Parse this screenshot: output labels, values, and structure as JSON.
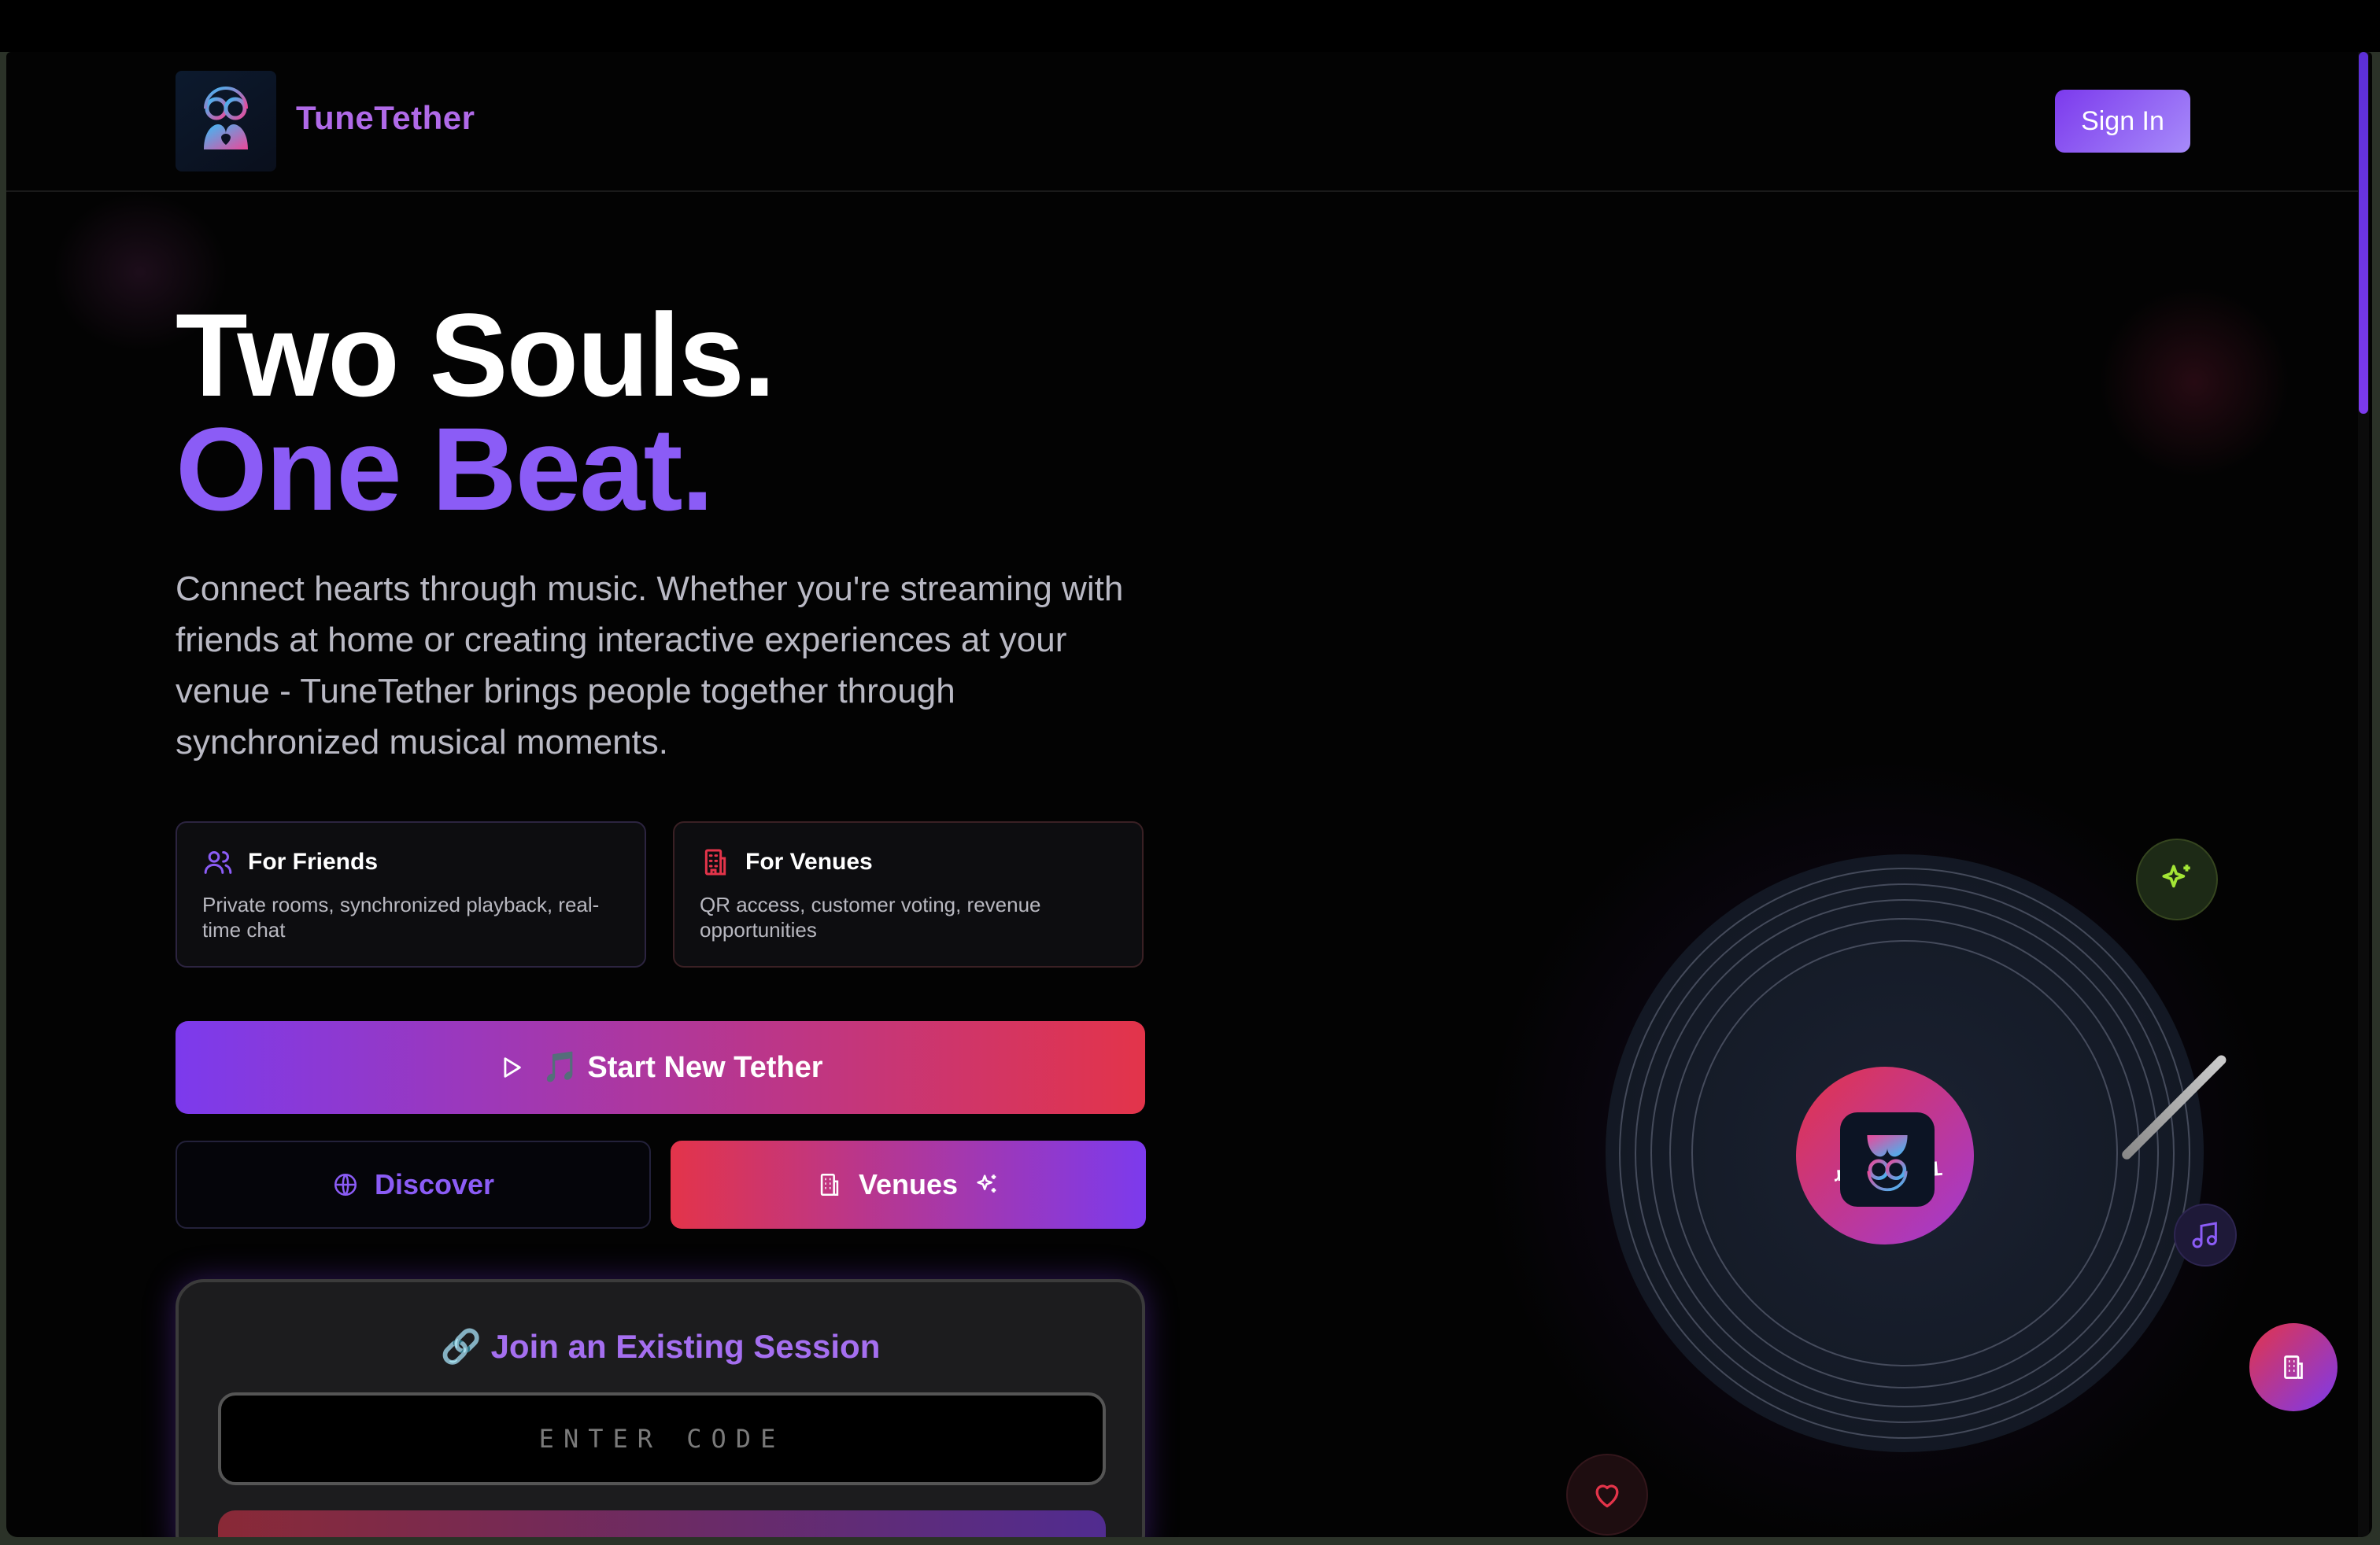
{
  "header": {
    "brand": "TuneTether",
    "signin_label": "Sign In"
  },
  "hero": {
    "line1": "Two Souls.",
    "line2": "One Beat.",
    "description": "Connect hearts through music. Whether you're streaming with friends at home or creating interactive experiences at your venue - TuneTether brings people together through synchronized musical moments."
  },
  "features": [
    {
      "title": "For Friends",
      "desc": "Private rooms, synchronized playback, real-time chat",
      "icon": "users-icon"
    },
    {
      "title": "For Venues",
      "desc": "QR access, customer voting, revenue opportunities",
      "icon": "building-icon"
    }
  ],
  "actions": {
    "start_label": "🎵 Start New Tether",
    "discover_label": "Discover",
    "venues_label": "Venues"
  },
  "join": {
    "title": "🔗 Join an Existing Session",
    "placeholder": "ENTER CODE"
  },
  "record": {
    "label_text": "TuneTether"
  },
  "colors": {
    "accent_purple": "#7c3aed",
    "accent_red": "#e3344a",
    "background": "#030303"
  }
}
